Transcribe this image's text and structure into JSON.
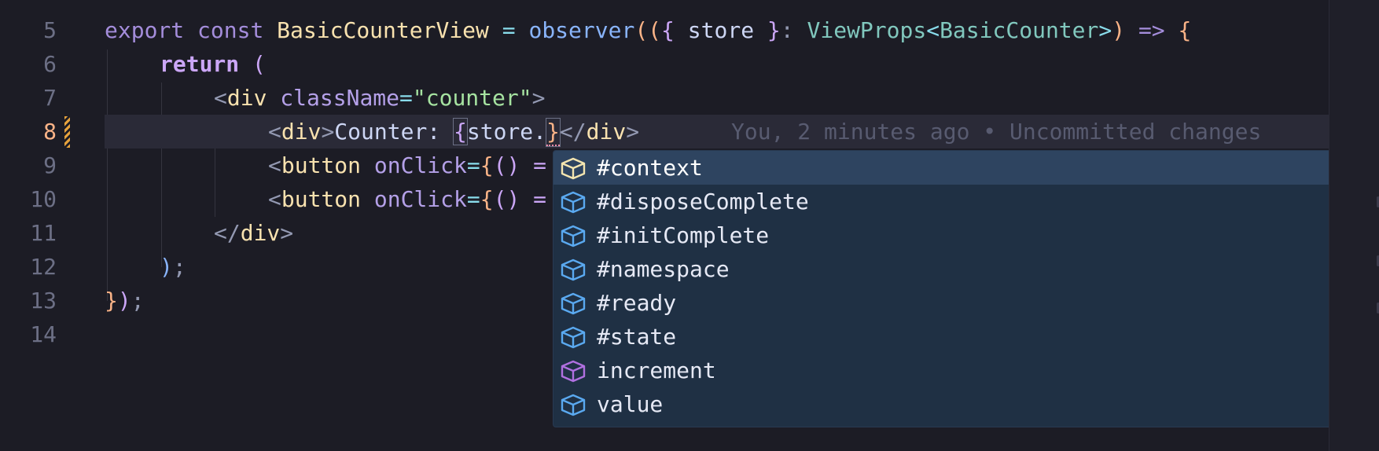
{
  "colors": {
    "editor_bg": "#1c1c25",
    "current_line": "#2a2a37",
    "suggest_bg": "#1f3044",
    "suggest_selected": "#2e4460",
    "property_icon": "#5aa9f0",
    "method_icon": "#b070e0",
    "git_modified": "#e6a23c"
  },
  "editor": {
    "line_numbers": [
      "5",
      "6",
      "7",
      "8",
      "9",
      "10",
      "11",
      "12",
      "13",
      "14"
    ],
    "active_line": "8",
    "lines": {
      "l5": {
        "export": "export",
        "const": "const",
        "name": "BasicCounterView",
        "eq": " = ",
        "observer": "observer",
        "open": "((",
        "brace_open": "{",
        "store": " store ",
        "brace_close": "}",
        "colon": ": ",
        "viewprops": "ViewProps",
        "lt": "<",
        "basiccounter": "BasicCounter",
        "gt": ">",
        "close": ")",
        "arrow": " => ",
        "body_open": "{"
      },
      "l6": {
        "return": "return",
        "paren": " ("
      },
      "l7": {
        "lt": "<",
        "div": "div",
        "classname": " className",
        "eq": "=",
        "value": "\"counter\"",
        "gt": ">"
      },
      "l8": {
        "lt": "<",
        "div": "div",
        "gt": ">",
        "text": "Counter: ",
        "brace_open": "{",
        "store": "store.",
        "brace_close": "}",
        "close_lt": "</",
        "close_div": "div",
        "close_gt": ">"
      },
      "l9": {
        "lt": "<",
        "button": "button",
        "onclick": " onClick",
        "eq": "=",
        "brace": "{",
        "parens": "() =",
        "rest": ""
      },
      "l10": {
        "lt": "<",
        "button": "button",
        "onclick": " onClick",
        "eq": "=",
        "brace": "{",
        "parens": "() ="
      },
      "l11": {
        "close_lt": "</",
        "div": "div",
        "gt": ">"
      },
      "l12": {
        "paren": ")",
        "semi": ";"
      },
      "l13": {
        "brace": "}",
        "paren": ")",
        "semi": ";"
      }
    },
    "blame": "You, 2 minutes ago • Uncommitted changes"
  },
  "suggestions": [
    {
      "label": "#context",
      "icon": "property-icon",
      "selected": true
    },
    {
      "label": "#disposeComplete",
      "icon": "property-icon",
      "selected": false
    },
    {
      "label": "#initComplete",
      "icon": "property-icon",
      "selected": false
    },
    {
      "label": "#namespace",
      "icon": "property-icon",
      "selected": false
    },
    {
      "label": "#ready",
      "icon": "property-icon",
      "selected": false
    },
    {
      "label": "#state",
      "icon": "property-icon",
      "selected": false
    },
    {
      "label": "increment",
      "icon": "method-icon",
      "selected": false
    },
    {
      "label": "value",
      "icon": "property-icon",
      "selected": false
    }
  ]
}
